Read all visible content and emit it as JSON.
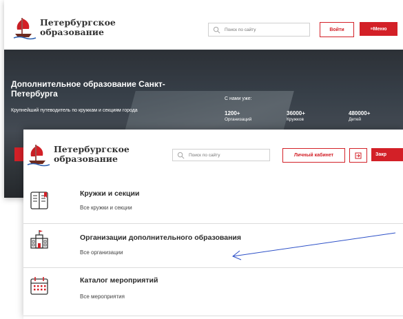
{
  "back_window": {
    "logo": {
      "line1": "Петербургское",
      "line2": "образование"
    },
    "search": {
      "placeholder": "Поиск по сайту"
    },
    "login_label": "Войти",
    "menu_label": "≡Меню",
    "hero": {
      "title": "Дополнительное образование Санкт-Петербурга",
      "subtitle": "Крупнейший путеводитель по кружкам и секциям города",
      "with_us": "С нами уже:",
      "stats": [
        {
          "value": "1200+",
          "label": "Организаций"
        },
        {
          "value": "36000+",
          "label": "Кружков"
        },
        {
          "value": "480000+",
          "label": "Детей"
        }
      ]
    }
  },
  "front_window": {
    "logo": {
      "line1": "Петербургское",
      "line2": "образование"
    },
    "search": {
      "placeholder": "Поиск по сайту"
    },
    "cabinet_label": "Личный кабинет",
    "close_label": "Закр",
    "menu": [
      {
        "title": "Кружки и секции",
        "subtitle": "Все кружки и секции",
        "icon": "book-icon"
      },
      {
        "title": "Организации дополнительного образования",
        "subtitle": "Все организации",
        "icon": "school-building-icon"
      },
      {
        "title": "Каталог мероприятий",
        "subtitle": "Все мероприятия",
        "icon": "calendar-icon"
      }
    ]
  },
  "colors": {
    "accent": "#d32027",
    "annotation_arrow": "#2b4fc7"
  }
}
